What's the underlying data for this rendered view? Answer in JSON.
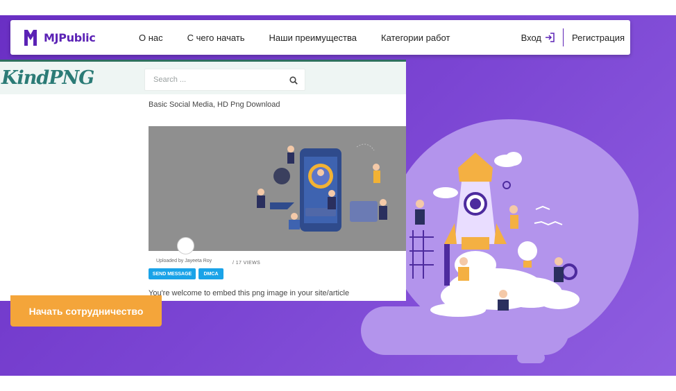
{
  "navbar": {
    "brand": "MJPublic",
    "links": [
      "О нас",
      "С чего начать",
      "Наши преимущества",
      "Категории работ"
    ],
    "login": "Вход",
    "register": "Регистрация"
  },
  "overlay": {
    "logo": "KindPNG",
    "search_placeholder": "Search ...",
    "title": "Basic Social Media, HD Png Download",
    "uploaded_by": "Uploaded by Jayeeta Roy",
    "views": "/ 17 VIEWS",
    "send_message": "SEND MESSAGE",
    "dmca": "DMCA",
    "welcome": "You're welcome to embed this png image in your site/article"
  },
  "hero": {
    "cta": "Начать сотрудничество"
  },
  "colors": {
    "brand_purple": "#5b22b5",
    "hero_purple": "#7b45d3",
    "cta_orange": "#f4a53a",
    "button_blue": "#1aa3e8"
  }
}
